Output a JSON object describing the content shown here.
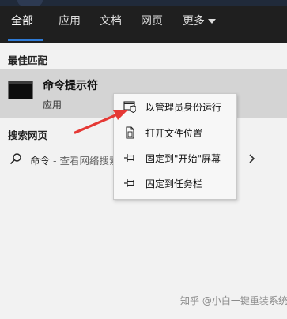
{
  "tabs": [
    "全部",
    "应用",
    "文档",
    "网页",
    "更多"
  ],
  "sections": {
    "best_match": "最佳匹配",
    "search_web": "搜索网页"
  },
  "best_match": {
    "title": "命令提示符",
    "subtitle": "应用"
  },
  "web_search": {
    "query": "命令",
    "hint": " - 查看网络搜索结果"
  },
  "context_menu": [
    {
      "label": "以管理员身份运行",
      "icon": "shield-run-icon"
    },
    {
      "label": "打开文件位置",
      "icon": "file-location-icon"
    },
    {
      "label": "固定到\"开始\"屏幕",
      "icon": "pin-icon"
    },
    {
      "label": "固定到任务栏",
      "icon": "pin-icon"
    }
  ],
  "watermark": "知乎 @小白一键重装系统",
  "colors": {
    "header_bg": "#1f1f1f",
    "accent": "#2f7bd6",
    "selected_row": "#d4d4d4",
    "arrow": "#e53935"
  }
}
